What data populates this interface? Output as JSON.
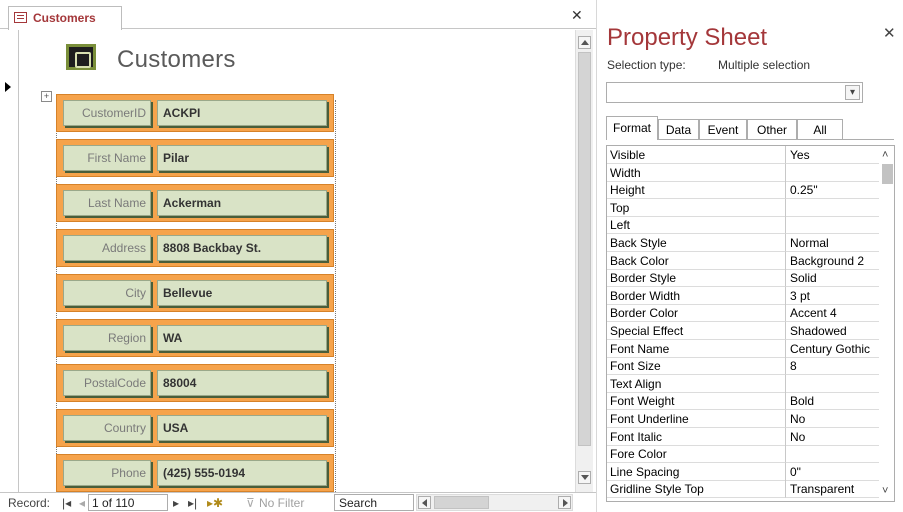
{
  "document": {
    "tab_title": "Customers",
    "form_title": "Customers",
    "fields": [
      {
        "label": "CustomerID",
        "value": "ACKPI"
      },
      {
        "label": "First Name",
        "value": "Pilar"
      },
      {
        "label": "Last Name",
        "value": "Ackerman"
      },
      {
        "label": "Address",
        "value": "8808 Backbay St."
      },
      {
        "label": "City",
        "value": "Bellevue"
      },
      {
        "label": "Region",
        "value": "WA"
      },
      {
        "label": "PostalCode",
        "value": "88004"
      },
      {
        "label": "Country",
        "value": "USA"
      },
      {
        "label": "Phone",
        "value": "(425) 555-0194"
      }
    ],
    "colors": {
      "accent": "#a4373a",
      "field_fill": "#d9e3c6",
      "row_border": "#f6a34b"
    }
  },
  "navigation": {
    "record_label": "Record:",
    "position": "1 of 110",
    "filter_label": "No Filter",
    "search_text": "Search"
  },
  "property_sheet": {
    "title": "Property Sheet",
    "selection_type_label": "Selection type:",
    "selection_type_value": "Multiple selection",
    "selector_value": "",
    "tabs": [
      "Format",
      "Data",
      "Event",
      "Other",
      "All"
    ],
    "active_tab": "Format",
    "properties": [
      {
        "name": "Visible",
        "value": "Yes"
      },
      {
        "name": "Width",
        "value": ""
      },
      {
        "name": "Height",
        "value": "0.25\""
      },
      {
        "name": "Top",
        "value": ""
      },
      {
        "name": "Left",
        "value": ""
      },
      {
        "name": "Back Style",
        "value": "Normal"
      },
      {
        "name": "Back Color",
        "value": "Background 2"
      },
      {
        "name": "Border Style",
        "value": "Solid"
      },
      {
        "name": "Border Width",
        "value": "3 pt"
      },
      {
        "name": "Border Color",
        "value": "Accent 4"
      },
      {
        "name": "Special Effect",
        "value": "Shadowed"
      },
      {
        "name": "Font Name",
        "value": "Century Gothic"
      },
      {
        "name": "Font Size",
        "value": "8"
      },
      {
        "name": "Text Align",
        "value": ""
      },
      {
        "name": "Font Weight",
        "value": "Bold"
      },
      {
        "name": "Font Underline",
        "value": "No"
      },
      {
        "name": "Font Italic",
        "value": "No"
      },
      {
        "name": "Fore Color",
        "value": ""
      },
      {
        "name": "Line Spacing",
        "value": "0\""
      },
      {
        "name": "Gridline Style Top",
        "value": "Transparent"
      }
    ]
  }
}
